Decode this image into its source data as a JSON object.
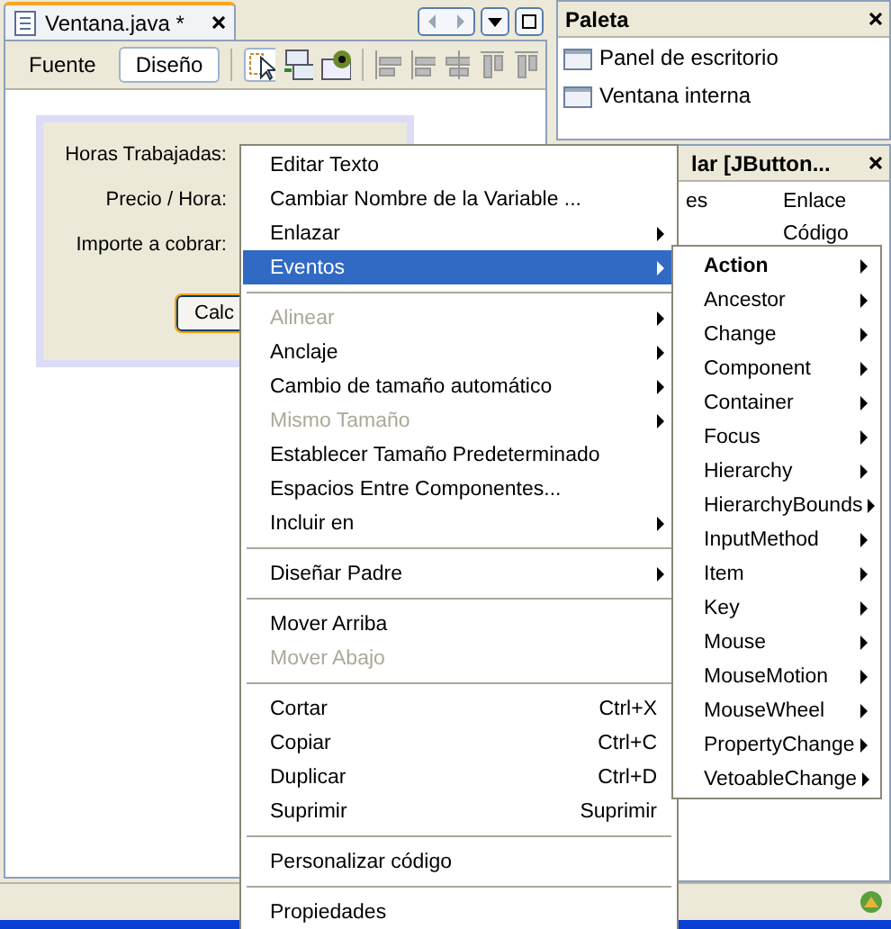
{
  "editor": {
    "tab_title": "Ventana.java *",
    "view_tabs": [
      {
        "label": "Fuente",
        "selected": false
      },
      {
        "label": "Diseño",
        "selected": true
      }
    ],
    "form": {
      "labels": [
        "Horas Trabajadas:",
        "Precio / Hora:",
        "Importe a cobrar:"
      ],
      "button": "Calc"
    }
  },
  "palette": {
    "title": "Paleta",
    "items": [
      "Panel de escritorio",
      "Ventana interna"
    ]
  },
  "properties": {
    "title": "lar [JButton...",
    "tabs": [
      "es",
      "Enlace",
      "Código"
    ]
  },
  "context_menu": [
    {
      "kind": "item",
      "label": "Editar Texto",
      "disabled": false,
      "submenu": false,
      "selected": false
    },
    {
      "kind": "item",
      "label": "Cambiar Nombre de la Variable ...",
      "disabled": false,
      "submenu": false,
      "selected": false
    },
    {
      "kind": "item",
      "label": "Enlazar",
      "disabled": false,
      "submenu": true,
      "selected": false
    },
    {
      "kind": "item",
      "label": "Eventos",
      "disabled": false,
      "submenu": true,
      "selected": true
    },
    {
      "kind": "separator"
    },
    {
      "kind": "item",
      "label": "Alinear",
      "disabled": true,
      "submenu": true,
      "selected": false
    },
    {
      "kind": "item",
      "label": "Anclaje",
      "disabled": false,
      "submenu": true,
      "selected": false
    },
    {
      "kind": "item",
      "label": "Cambio de tamaño automático",
      "disabled": false,
      "submenu": true,
      "selected": false
    },
    {
      "kind": "item",
      "label": "Mismo Tamaño",
      "disabled": true,
      "submenu": true,
      "selected": false
    },
    {
      "kind": "item",
      "label": "Establecer Tamaño Predeterminado",
      "disabled": false,
      "submenu": false,
      "selected": false
    },
    {
      "kind": "item",
      "label": "Espacios Entre Componentes...",
      "disabled": false,
      "submenu": false,
      "selected": false
    },
    {
      "kind": "item",
      "label": "Incluir en",
      "disabled": false,
      "submenu": true,
      "selected": false
    },
    {
      "kind": "separator"
    },
    {
      "kind": "item",
      "label": "Diseñar Padre",
      "disabled": false,
      "submenu": true,
      "selected": false
    },
    {
      "kind": "separator"
    },
    {
      "kind": "item",
      "label": "Mover Arriba",
      "disabled": false,
      "submenu": false,
      "selected": false
    },
    {
      "kind": "item",
      "label": "Mover Abajo",
      "disabled": true,
      "submenu": false,
      "selected": false
    },
    {
      "kind": "separator"
    },
    {
      "kind": "item",
      "label": "Cortar",
      "shortcut": "Ctrl+X",
      "disabled": false,
      "submenu": false,
      "selected": false
    },
    {
      "kind": "item",
      "label": "Copiar",
      "shortcut": "Ctrl+C",
      "disabled": false,
      "submenu": false,
      "selected": false
    },
    {
      "kind": "item",
      "label": "Duplicar",
      "shortcut": "Ctrl+D",
      "disabled": false,
      "submenu": false,
      "selected": false
    },
    {
      "kind": "item",
      "label": "Suprimir",
      "shortcut": "Suprimir",
      "disabled": false,
      "submenu": false,
      "selected": false
    },
    {
      "kind": "separator"
    },
    {
      "kind": "item",
      "label": "Personalizar código",
      "disabled": false,
      "submenu": false,
      "selected": false
    },
    {
      "kind": "separator"
    },
    {
      "kind": "item",
      "label": "Propiedades",
      "disabled": false,
      "submenu": false,
      "selected": false
    }
  ],
  "events_submenu": [
    {
      "label": "Action",
      "default": true
    },
    {
      "label": "Ancestor",
      "default": false
    },
    {
      "label": "Change",
      "default": false
    },
    {
      "label": "Component",
      "default": false
    },
    {
      "label": "Container",
      "default": false
    },
    {
      "label": "Focus",
      "default": false
    },
    {
      "label": "Hierarchy",
      "default": false
    },
    {
      "label": "HierarchyBounds",
      "default": false
    },
    {
      "label": "InputMethod",
      "default": false
    },
    {
      "label": "Item",
      "default": false
    },
    {
      "label": "Key",
      "default": false
    },
    {
      "label": "Mouse",
      "default": false
    },
    {
      "label": "MouseMotion",
      "default": false
    },
    {
      "label": "MouseWheel",
      "default": false
    },
    {
      "label": "PropertyChange",
      "default": false
    },
    {
      "label": "VetoableChange",
      "default": false
    }
  ]
}
